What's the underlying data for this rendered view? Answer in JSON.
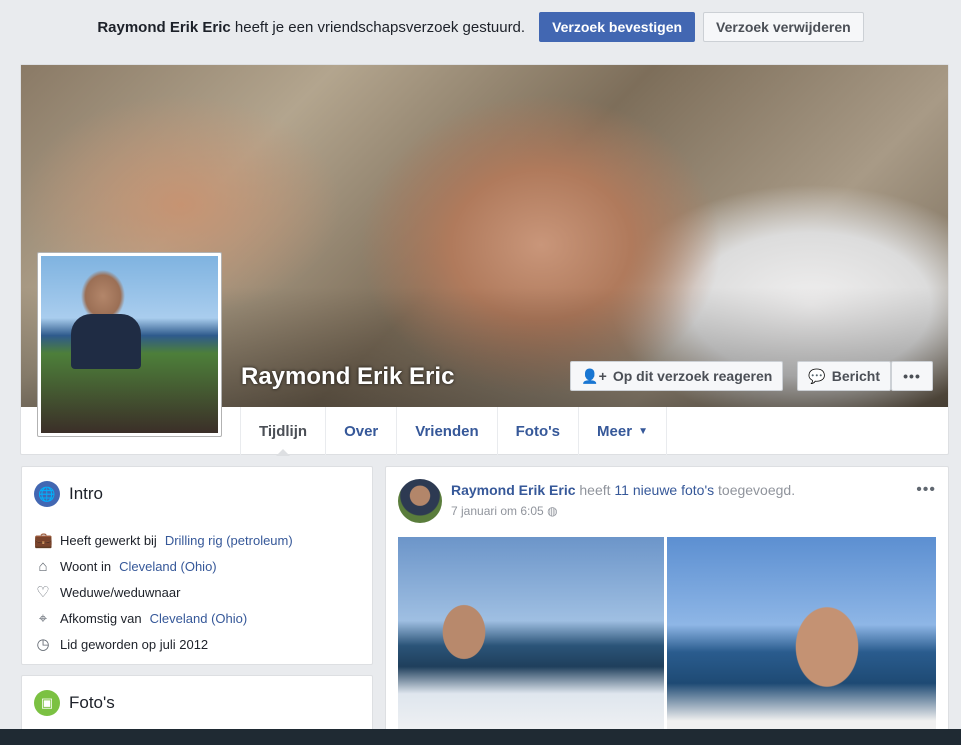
{
  "request": {
    "name": "Raymond Erik Eric",
    "text": "heeft je een vriendschapsverzoek gestuurd.",
    "confirm": "Verzoek bevestigen",
    "delete": "Verzoek verwijderen"
  },
  "profile": {
    "name": "Raymond Erik Eric",
    "respond": "Op dit verzoek reageren",
    "message": "Bericht",
    "more": "•••"
  },
  "tabs": [
    "Tijdlijn",
    "Over",
    "Vrienden",
    "Foto's",
    "Meer"
  ],
  "intro": {
    "title": "Intro",
    "items": [
      {
        "icon": "briefcase-icon",
        "text": "Heeft gewerkt bij ",
        "link": "Drilling rig (petroleum)"
      },
      {
        "icon": "home-icon",
        "text": "Woont in ",
        "link": "Cleveland (Ohio)"
      },
      {
        "icon": "heart-icon",
        "text": "Weduwe/weduwnaar",
        "link": ""
      },
      {
        "icon": "location-pin-icon",
        "text": "Afkomstig van ",
        "link": "Cleveland (Ohio)"
      },
      {
        "icon": "clock-icon",
        "text": "Lid geworden op juli 2012",
        "link": ""
      }
    ]
  },
  "photos": {
    "title": "Foto's"
  },
  "post": {
    "author": "Raymond Erik Eric",
    "verb": "heeft",
    "count_text": "11 nieuwe foto's",
    "suffix": "toegevoegd.",
    "date": "7 januari om 6:05",
    "more": "•••"
  }
}
